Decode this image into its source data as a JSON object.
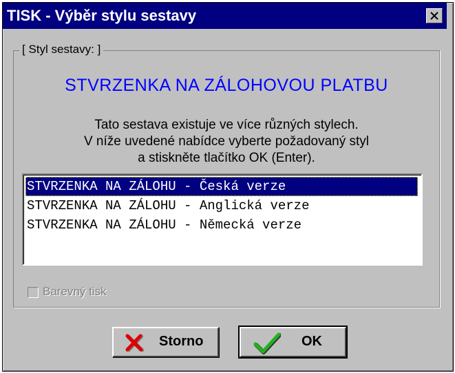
{
  "window": {
    "title": "TISK - Výběr stylu sestavy"
  },
  "group": {
    "legend": "[ Styl sestavy: ]",
    "report_title": "STVRZENKA NA ZÁLOHOVOU PLATBU",
    "instructions": [
      "Tato sestava existuje ve více různých stylech.",
      "V níže uvedené nabídce vyberte požadovaný styl",
      "a stiskněte tlačítko OK (Enter)."
    ]
  },
  "list": {
    "items": [
      "STVRZENKA NA ZÁLOHU - Česká verze",
      "STVRZENKA NA ZÁLOHU - Anglická verze",
      "STVRZENKA NA ZÁLOHU - Německá verze"
    ],
    "selected_index": 0
  },
  "checkbox": {
    "label": "Barevný tisk",
    "checked": false,
    "enabled": false
  },
  "buttons": {
    "cancel_label": "Storno",
    "ok_label": "OK"
  },
  "icons": {
    "close": "close-icon",
    "cancel": "red-x-icon",
    "ok": "green-checkmark-icon"
  },
  "colors": {
    "titlebar": "#000080",
    "report_title": "#0000ff",
    "selection": "#000080",
    "dialog_face": "#c0c0c0"
  }
}
